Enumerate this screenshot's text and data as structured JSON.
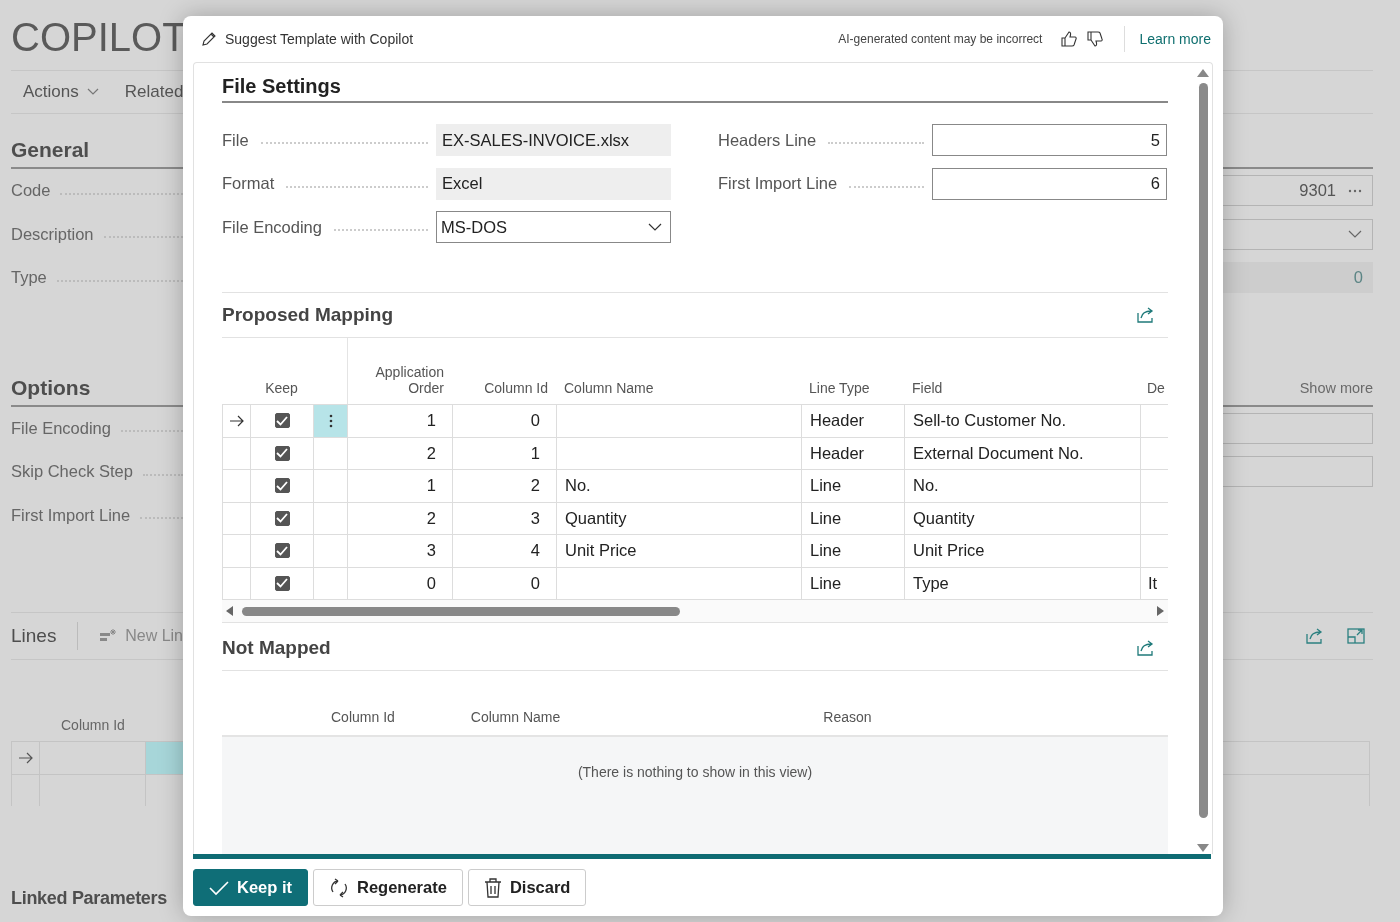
{
  "background_page": {
    "title": "COPILOT",
    "actions": [
      {
        "label": "Actions",
        "kind": "menu"
      },
      {
        "label": "Related",
        "kind": "plain"
      }
    ],
    "general": {
      "heading": "General",
      "fields": [
        {
          "label": "Code",
          "kind": "lookup",
          "value": "9301"
        },
        {
          "label": "Description",
          "kind": "dropdown"
        },
        {
          "label": "Type",
          "kind": "readonly",
          "value": "0"
        }
      ]
    },
    "options": {
      "heading": "Options",
      "show_more": "Show more",
      "fields": [
        {
          "label": "File Encoding",
          "kind": "box"
        },
        {
          "label": "Skip Check Step",
          "kind": "box"
        },
        {
          "label": "First Import Line",
          "kind": "none"
        }
      ]
    },
    "lines": {
      "heading": "Lines",
      "new_line": "New Lin",
      "column_header": "Column Id",
      "rows": [
        {
          "selected": true
        },
        {
          "selected": false
        }
      ]
    },
    "linked_heading": "Linked Parameters"
  },
  "dialog": {
    "title": "Suggest Template with Copilot",
    "disclaimer": "AI-generated content may be incorrect",
    "learn_more": "Learn more",
    "file_settings": {
      "heading": "File Settings",
      "left_fields": [
        {
          "label": "File",
          "kind": "readonly",
          "value": "EX-SALES-INVOICE.xlsx"
        },
        {
          "label": "Format",
          "kind": "readonly",
          "value": "Excel"
        },
        {
          "label": "File Encoding",
          "kind": "dropdown",
          "value": "MS-DOS"
        }
      ],
      "right_fields": [
        {
          "label": "Headers Line",
          "kind": "number",
          "value": "5"
        },
        {
          "label": "First Import Line",
          "kind": "number",
          "value": "6"
        }
      ]
    },
    "proposed_mapping": {
      "heading": "Proposed Mapping",
      "columns": [
        "Keep",
        "Application Order",
        "Column Id",
        "Column Name",
        "Line Type",
        "Field",
        "De"
      ],
      "rows": [
        {
          "selected": true,
          "keep": true,
          "application_order": "1",
          "column_id": "0",
          "line_type": "Header",
          "field": "Sell-to Customer No."
        },
        {
          "selected": false,
          "keep": true,
          "application_order": "2",
          "column_id": "1",
          "line_type": "Header",
          "field": "External Document No."
        },
        {
          "selected": false,
          "keep": true,
          "application_order": "1",
          "column_id": "2",
          "column_name": "No.",
          "line_type": "Line",
          "field": "No."
        },
        {
          "selected": false,
          "keep": true,
          "application_order": "2",
          "column_id": "3",
          "column_name": "Quantity",
          "line_type": "Line",
          "field": "Quantity"
        },
        {
          "selected": false,
          "keep": true,
          "application_order": "3",
          "column_id": "4",
          "column_name": "Unit Price",
          "line_type": "Line",
          "field": "Unit Price"
        },
        {
          "selected": false,
          "keep": true,
          "application_order": "0",
          "column_id": "0",
          "line_type": "Line",
          "field": "Type",
          "column_8": "It"
        }
      ]
    },
    "not_mapped": {
      "heading": "Not Mapped",
      "columns": [
        "Column Id",
        "Column Name",
        "Reason"
      ],
      "empty_message": "(There is nothing to show in this view)"
    },
    "buttons": [
      {
        "label": "Keep it",
        "kind": "primary"
      },
      {
        "label": "Regenerate",
        "kind": "regenerate"
      },
      {
        "label": "Discard",
        "kind": "discard"
      }
    ]
  }
}
